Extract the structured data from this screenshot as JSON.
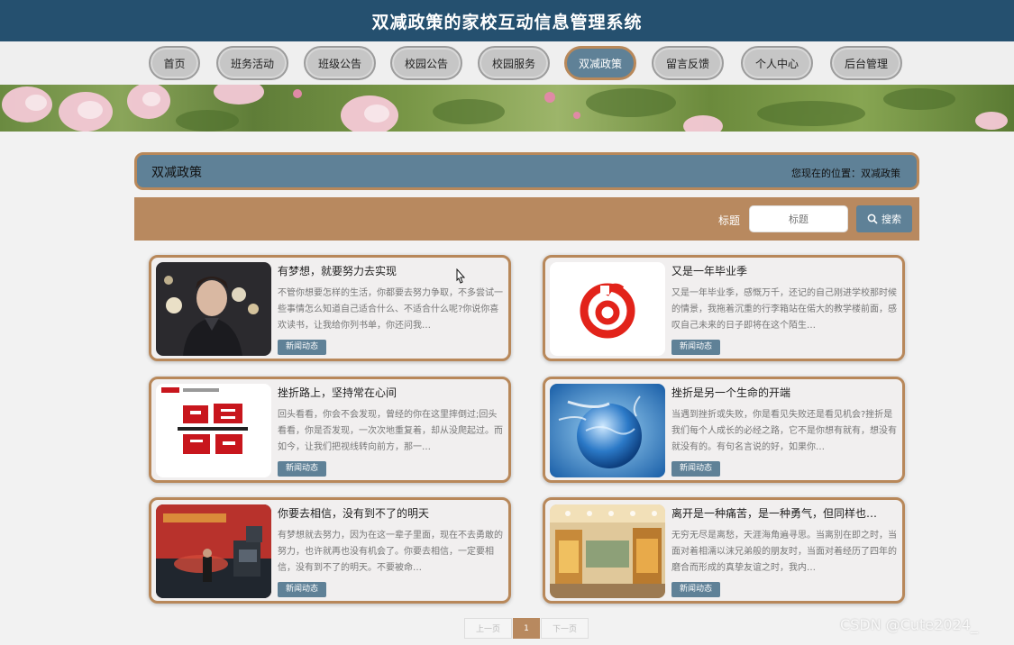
{
  "site": {
    "title": "双减政策的家校互动信息管理系统"
  },
  "nav": [
    {
      "label": "首页"
    },
    {
      "label": "班务活动"
    },
    {
      "label": "班级公告"
    },
    {
      "label": "校园公告"
    },
    {
      "label": "校园服务"
    },
    {
      "label": "双减政策",
      "active": true
    },
    {
      "label": "留言反馈"
    },
    {
      "label": "个人中心"
    },
    {
      "label": "后台管理"
    }
  ],
  "page": {
    "title": "双减政策",
    "breadcrumb": "您现在的位置：双减政策"
  },
  "search": {
    "label": "标题",
    "placeholder": "标题",
    "button_label": "搜索",
    "icon": "search-icon"
  },
  "cards": [
    {
      "title": "有梦想，就要努力去实现",
      "desc": "不管你想要怎样的生活，你都要去努力争取，不多尝试一些事情怎么知道自己适合什么、不适合什么呢?你说你喜欢读书，让我给你列书单，你还问我…",
      "tag": "新闻动态",
      "image": "person-portrait-image"
    },
    {
      "title": "又是一年毕业季",
      "desc": "又是一年毕业季，感慨万千，还记的自己刚进学校那时候的情景，我拖着沉重的行李箱站在偌大的教学楼前面，感叹自己未来的日子即将在这个陌生…",
      "tag": "新闻动态",
      "image": "music-logo-image"
    },
    {
      "title": "挫折路上，坚持常在心间",
      "desc": "回头看看，你会不会发现，曾经的你在这里摔倒过;回头看看，你是否发现，一次次地重复着，却从没爬起过。而如今，让我们把视线转向前方，那一…",
      "tag": "新闻动态",
      "image": "current-affairs-image",
      "image_text": "时事\n政治"
    },
    {
      "title": "挫折是另一个生命的开端",
      "desc": "当遇到挫折或失败，你是看见失败还是看见机会?挫折是我们每个人成长的必经之路，它不是你想有就有，想没有就没有的。有句名言说的好，如果你…",
      "tag": "新闻动态",
      "image": "globe-image"
    },
    {
      "title": "你要去相信，没有到不了的明天",
      "desc": "有梦想就去努力，因为在这一辈子里面，现在不去勇敢的努力，也许就再也没有机会了。你要去相信，一定要相信，没有到不了的明天。不要被命…",
      "tag": "新闻动态",
      "image": "stage-image"
    },
    {
      "title": "离开是一种痛苦，是一种勇气，但同样也…",
      "desc": "无穷无尽是离愁，天涯海角遍寻思。当离别在即之时，当面对着相濡以沫兄弟般的朋友时，当面对着经历了四年的磨合而形成的真挚友谊之时，我内…",
      "tag": "新闻动态",
      "image": "store-image"
    }
  ],
  "pagination": {
    "prev": "上一页",
    "current": "1",
    "next": "下一页"
  },
  "watermark": "CSDN @Cute2024_",
  "colors": {
    "header": "#25506f",
    "accent_blue": "#5f8197",
    "accent_brown": "#b8885a"
  }
}
